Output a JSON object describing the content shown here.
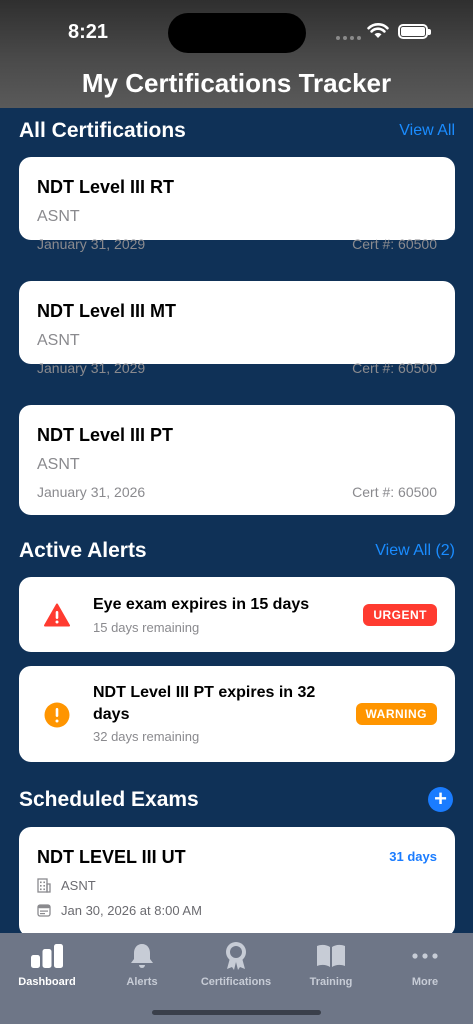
{
  "status_bar": {
    "time": "8:21"
  },
  "header": {
    "title": "My Certifications Tracker"
  },
  "certifications": {
    "title": "All Certifications",
    "view_all": "View All",
    "items": [
      {
        "name": "NDT Level III RT",
        "org": "ASNT",
        "date": "January 31, 2029",
        "cert": "Cert #: 60500"
      },
      {
        "name": "NDT Level III MT",
        "org": "ASNT",
        "date": "January 31, 2029",
        "cert": "Cert #: 60500"
      },
      {
        "name": "NDT Level III PT",
        "org": "ASNT",
        "date": "January 31, 2026",
        "cert": "Cert #: 60500"
      }
    ]
  },
  "alerts": {
    "title": "Active Alerts",
    "view_all": "View All (2)",
    "items": [
      {
        "title": "Eye exam expires in 15 days",
        "sub": "15 days remaining",
        "badge": "URGENT",
        "color": "#ff3b30"
      },
      {
        "title": "NDT Level III PT expires in 32 days",
        "sub": "32 days remaining",
        "badge": "WARNING",
        "color": "#ff9500"
      }
    ]
  },
  "exams": {
    "title": "Scheduled Exams",
    "items": [
      {
        "name": "NDT LEVEL III UT",
        "days": "31 days",
        "org": "ASNT",
        "when": "Jan 30, 2026 at 8:00 AM"
      }
    ]
  },
  "tabbar": {
    "items": [
      {
        "label": "Dashboard",
        "icon": "chart-bars-icon"
      },
      {
        "label": "Alerts",
        "icon": "bell-icon"
      },
      {
        "label": "Certifications",
        "icon": "award-icon"
      },
      {
        "label": "Training",
        "icon": "book-icon"
      },
      {
        "label": "More",
        "icon": "ellipsis-icon"
      }
    ]
  },
  "colors": {
    "accent": "#1a7cff",
    "background": "#0f3157",
    "urgent": "#ff3b30",
    "warning": "#ff9500"
  }
}
